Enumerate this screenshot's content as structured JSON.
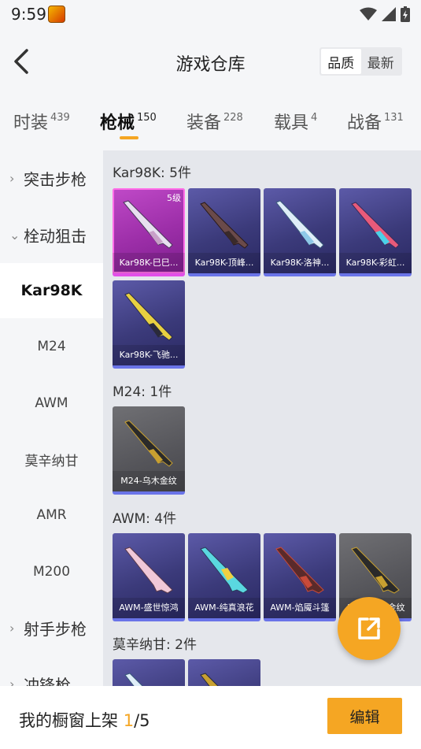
{
  "status_bar": {
    "time": "9:59"
  },
  "header": {
    "title": "游戏仓库",
    "sort_options": [
      "品质",
      "最新"
    ]
  },
  "tabs": [
    {
      "label": "时装",
      "count": "439"
    },
    {
      "label": "枪械",
      "count": "150"
    },
    {
      "label": "装备",
      "count": "228"
    },
    {
      "label": "载具",
      "count": "4"
    },
    {
      "label": "战备",
      "count": "131"
    }
  ],
  "sidebar": {
    "groups": [
      {
        "label": "突击步枪"
      },
      {
        "label": "栓动狙击"
      },
      {
        "label": "射手步枪"
      },
      {
        "label": "冲锋枪"
      }
    ],
    "items": [
      "Kar98K",
      "M24",
      "AWM",
      "莫辛纳甘",
      "AMR",
      "M200"
    ]
  },
  "sections": [
    {
      "title": "Kar98K: 5件",
      "cards": [
        {
          "name": "Kar98K-巳巳...",
          "level": "5级"
        },
        {
          "name": "Kar98K-顶峰..."
        },
        {
          "name": "Kar98K-洛神..."
        },
        {
          "name": "Kar98K-彩虹..."
        },
        {
          "name": "Kar98K-飞驰..."
        }
      ]
    },
    {
      "title": "M24: 1件",
      "cards": [
        {
          "name": "M24-乌木金纹"
        }
      ]
    },
    {
      "title": "AWM: 4件",
      "cards": [
        {
          "name": "AWM-盛世惊鸿"
        },
        {
          "name": "AWM-纯真浪花"
        },
        {
          "name": "AWM-焰魇斗篷"
        },
        {
          "name": "AWM-乌木金纹"
        }
      ]
    },
    {
      "title": "莫辛纳甘: 2件",
      "cards": []
    }
  ],
  "bottom_bar": {
    "label": "我的橱窗上架",
    "current": "1",
    "total": "/5",
    "edit_label": "编辑"
  },
  "colors": {
    "accent": "#f5a623",
    "purple_card": "#3b3a7a",
    "pink_card": "#9c2ea8",
    "gray_card": "#55555a"
  },
  "icons": [
    "back-arrow-icon",
    "chevron-right-icon",
    "chevron-down-icon",
    "share-external-icon",
    "wifi-icon",
    "cell-signal-icon",
    "battery-icon"
  ]
}
